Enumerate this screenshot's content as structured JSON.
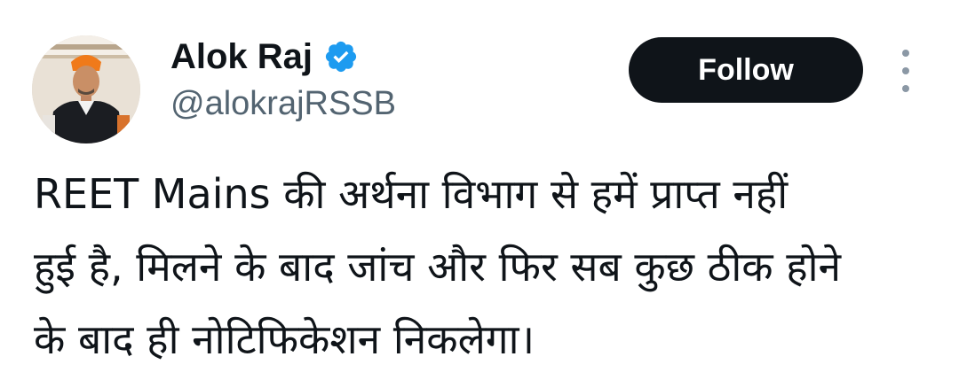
{
  "author": {
    "display_name": "Alok Raj",
    "handle": "@alokrajRSSB",
    "verified_icon": "verified-badge-icon",
    "accent_color": "#1d9bf0"
  },
  "actions": {
    "follow_label": "Follow",
    "more_icon": "vertical-ellipsis-icon"
  },
  "tweet": {
    "lines": [
      "REET Mains की अर्थना विभाग से हमें प्राप्त नहीं",
      "हुई है, मिलने के बाद जांच और फिर सब कुछ ठीक होने",
      "के बाद ही नोटिफिकेशन निकलेगा।"
    ]
  }
}
